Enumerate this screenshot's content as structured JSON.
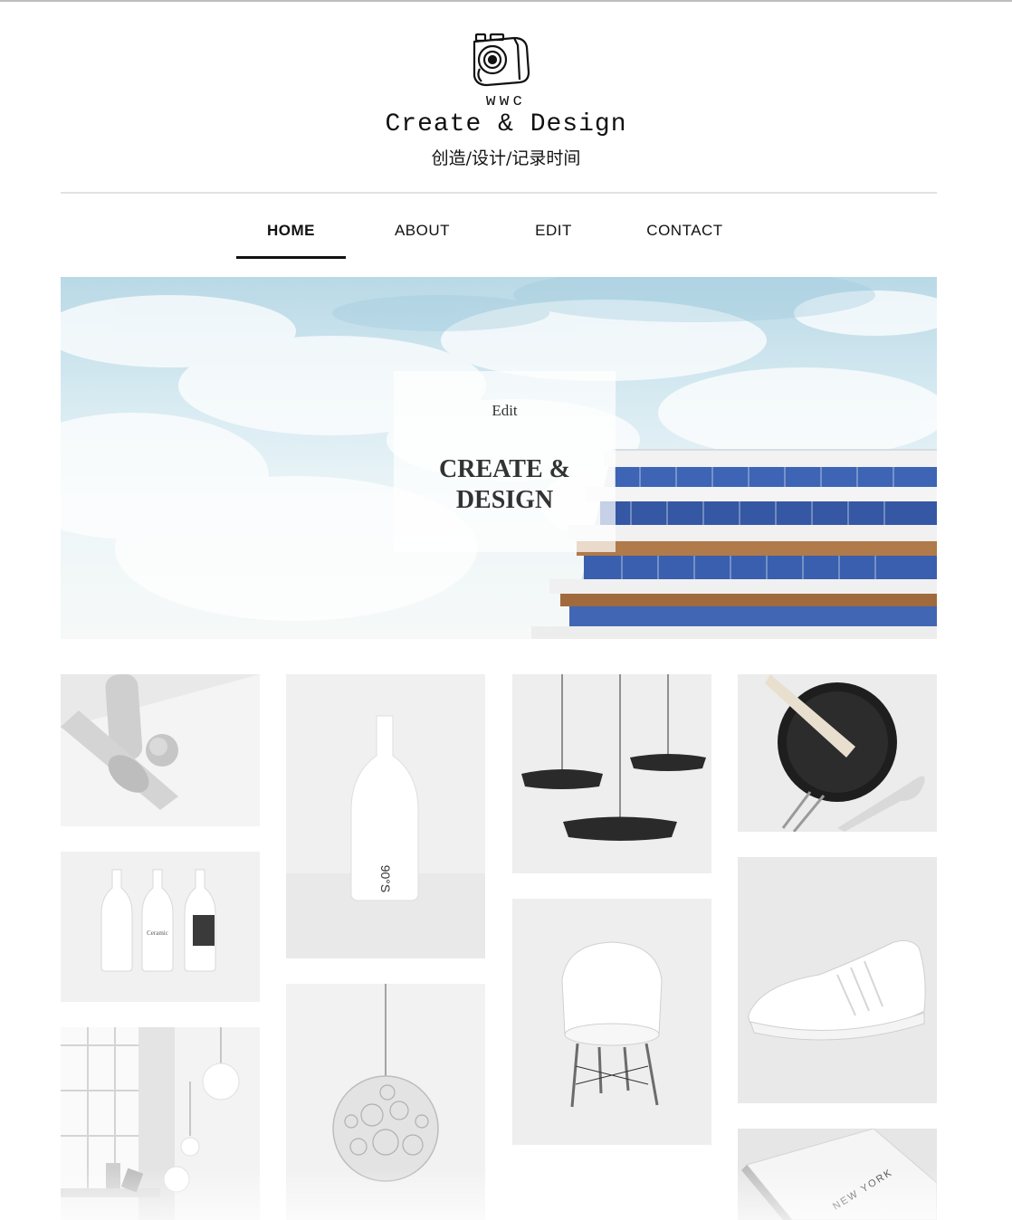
{
  "brand": {
    "logo_icon": "camera-icon",
    "small": "wwc",
    "title": "Create & Design",
    "subtitle": "创造/设计/记录时间"
  },
  "nav": {
    "items": [
      {
        "label": "HOME",
        "active": true
      },
      {
        "label": "ABOUT",
        "active": false
      },
      {
        "label": "EDIT",
        "active": false
      },
      {
        "label": "CONTACT",
        "active": false
      }
    ]
  },
  "hero": {
    "kicker": "Edit",
    "headline_line1": "CREATE &",
    "headline_line2": "DESIGN"
  },
  "gallery": {
    "bottle_label": "90°S",
    "notebook_label": "NEW YORK",
    "ceramic_label": "Ceramic",
    "items": [
      "spoons-and-ball",
      "white-bottles-trio",
      "window-and-lamps",
      "white-bottle",
      "pendant-ball-lamp",
      "pendant-lamps",
      "white-chair",
      "frying-pan-and-spoon",
      "white-sneaker",
      "notebook"
    ]
  },
  "colors": {
    "accent": "#111111",
    "rule": "#e2e2e2",
    "sky": "#cfe6ee",
    "glass": "#3d64b5"
  }
}
